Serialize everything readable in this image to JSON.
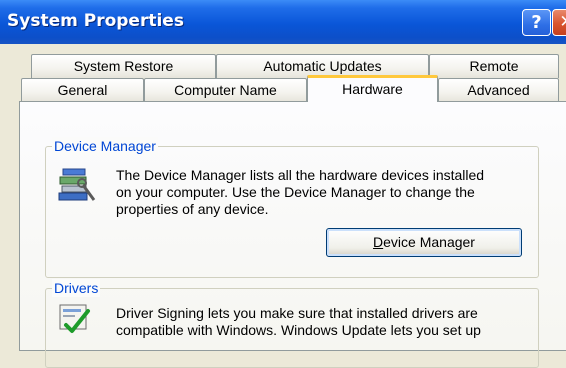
{
  "window": {
    "title": "System Properties"
  },
  "titlebar_buttons": {
    "help": "?",
    "close": "✕"
  },
  "tabs_row1": [
    {
      "label": "System Restore"
    },
    {
      "label": "Automatic Updates"
    },
    {
      "label": "Remote"
    }
  ],
  "tabs_row2": [
    {
      "label": "General"
    },
    {
      "label": "Computer Name"
    },
    {
      "label": "Hardware",
      "selected": true
    },
    {
      "label": "Advanced"
    }
  ],
  "device_manager": {
    "legend": "Device Manager",
    "lines": [
      "The Device Manager lists all the hardware devices installed",
      "on your computer. Use the Device Manager to change the",
      "properties of any device."
    ],
    "button": {
      "accel": "D",
      "rest": "evice Manager"
    },
    "icon": "device-manager-icon"
  },
  "drivers": {
    "legend": "Drivers",
    "lines": [
      "Driver Signing lets you make sure that installed drivers are",
      "compatible with Windows. Windows Update lets you set up"
    ],
    "icon": "driver-signing-icon"
  },
  "colors": {
    "titlebar": "#0a56d8",
    "window_bg": "#ece9d8",
    "selected_tab_accent": "#ffc83c",
    "group_legend": "#0046d5"
  }
}
